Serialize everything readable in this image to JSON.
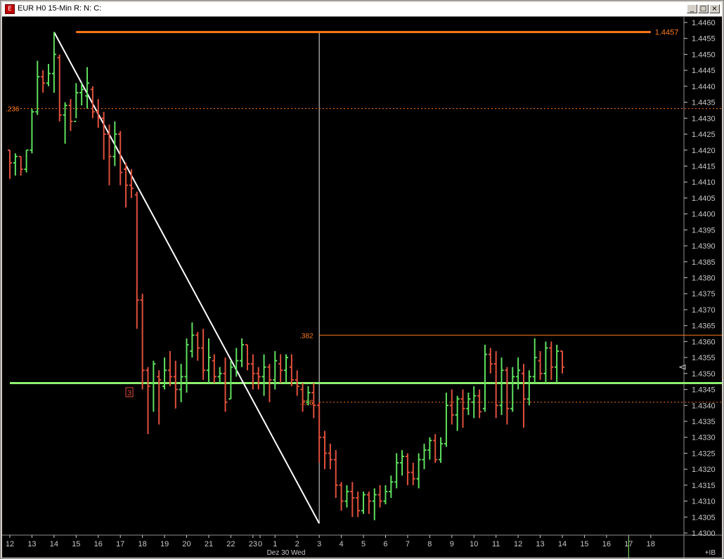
{
  "window": {
    "title": "EUR H0 15-Min R: N: C:",
    "icon": "chart-window-icon",
    "controls": {
      "minimize": "_",
      "maximize": "□",
      "close": "×"
    }
  },
  "colors": {
    "background": "#000000",
    "up_bar": "#5ee05e",
    "down_bar": "#e0503c",
    "neutral_bar": "#c8c8c8",
    "fib": "#ff7a1a",
    "support": "#90f070",
    "trendline": "#ffffff",
    "axis": "#c8c8c8"
  },
  "chart_data": {
    "type": "ohlc",
    "symbol": "EUR H0",
    "interval": "15-Min",
    "y_ticks": [
      "1.4460",
      "1.4455",
      "1.4450",
      "1.4445",
      "1.4440",
      "1.4435",
      "1.4430",
      "1.4425",
      "1.4420",
      "1.4415",
      "1.4410",
      "1.4405",
      "1.4400",
      "1.4395",
      "1.4390",
      "1.4385",
      "1.4380",
      "1.4375",
      "1.4370",
      "1.4365",
      "1.4360",
      "1.4355",
      "1.4350",
      "1.4345",
      "1.4340",
      "1.4335",
      "1.4330",
      "1.4325",
      "1.4320",
      "1.4315",
      "1.4310",
      "1.4305",
      "1.4300"
    ],
    "ylim": [
      1.43,
      1.446
    ],
    "x_ticks": [
      {
        "label": "12",
        "index": 0
      },
      {
        "label": "13",
        "index": 4
      },
      {
        "label": "14",
        "index": 8
      },
      {
        "label": "15",
        "index": 12
      },
      {
        "label": "16",
        "index": 16
      },
      {
        "label": "17",
        "index": 20
      },
      {
        "label": "18",
        "index": 24
      },
      {
        "label": "19",
        "index": 28
      },
      {
        "label": "20",
        "index": 32
      },
      {
        "label": "21",
        "index": 36
      },
      {
        "label": "22",
        "index": 40
      },
      {
        "label": "23",
        "index": 44
      },
      {
        "label": "0",
        "index": 45.3
      },
      {
        "label": "1",
        "index": 48
      },
      {
        "label": "2",
        "index": 52
      },
      {
        "label": "3",
        "index": 56
      },
      {
        "label": "4",
        "index": 60
      },
      {
        "label": "5",
        "index": 64
      },
      {
        "label": "6",
        "index": 68
      },
      {
        "label": "7",
        "index": 72
      },
      {
        "label": "8",
        "index": 76
      },
      {
        "label": "9",
        "index": 80
      },
      {
        "label": "10",
        "index": 84
      },
      {
        "label": "11",
        "index": 88
      },
      {
        "label": "12",
        "index": 92
      },
      {
        "label": "13",
        "index": 96
      },
      {
        "label": "14",
        "index": 100
      },
      {
        "label": "15",
        "index": 104
      },
      {
        "label": "16",
        "index": 108
      },
      {
        "label": "17",
        "index": 112
      },
      {
        "label": "18",
        "index": 116
      }
    ],
    "date_label": {
      "text": "Dez 30 Wed",
      "index": 50
    },
    "current_price_marker": 1.4352,
    "y_axis_extra": "+IB",
    "bars": [
      {
        "o": 1.442,
        "h": 1.442,
        "l": 1.4411,
        "c": 1.4416
      },
      {
        "o": 1.4416,
        "h": 1.4419,
        "l": 1.4412,
        "c": 1.4418
      },
      {
        "o": 1.4418,
        "h": 1.4418,
        "l": 1.4412,
        "c": 1.4414
      },
      {
        "o": 1.4414,
        "h": 1.442,
        "l": 1.4413,
        "c": 1.442
      },
      {
        "o": 1.442,
        "h": 1.4433,
        "l": 1.4419,
        "c": 1.4432
      },
      {
        "o": 1.4432,
        "h": 1.4448,
        "l": 1.4431,
        "c": 1.4443
      },
      {
        "o": 1.4443,
        "h": 1.4445,
        "l": 1.4438,
        "c": 1.4441
      },
      {
        "o": 1.4441,
        "h": 1.4447,
        "l": 1.444,
        "c": 1.4444
      },
      {
        "o": 1.4444,
        "h": 1.4457,
        "l": 1.4438,
        "c": 1.445
      },
      {
        "o": 1.4449,
        "h": 1.445,
        "l": 1.4429,
        "c": 1.4431
      },
      {
        "o": 1.4431,
        "h": 1.4435,
        "l": 1.4422,
        "c": 1.4434
      },
      {
        "o": 1.4434,
        "h": 1.4436,
        "l": 1.4426,
        "c": 1.4429
      },
      {
        "o": 1.4429,
        "h": 1.4441,
        "l": 1.443,
        "c": 1.4438
      },
      {
        "o": 1.4438,
        "h": 1.4441,
        "l": 1.4434,
        "c": 1.4439
      },
      {
        "o": 1.4437,
        "h": 1.4446,
        "l": 1.4433,
        "c": 1.4441
      },
      {
        "o": 1.4439,
        "h": 1.444,
        "l": 1.443,
        "c": 1.4432
      },
      {
        "o": 1.4432,
        "h": 1.4436,
        "l": 1.4427,
        "c": 1.443
      },
      {
        "o": 1.443,
        "h": 1.4432,
        "l": 1.4417,
        "c": 1.4425
      },
      {
        "o": 1.4425,
        "h": 1.4428,
        "l": 1.4409,
        "c": 1.4418
      },
      {
        "o": 1.4418,
        "h": 1.4429,
        "l": 1.4415,
        "c": 1.4425
      },
      {
        "o": 1.4425,
        "h": 1.4426,
        "l": 1.4409,
        "c": 1.4413
      },
      {
        "o": 1.4414,
        "h": 1.4416,
        "l": 1.4402,
        "c": 1.4409
      },
      {
        "o": 1.4409,
        "h": 1.4414,
        "l": 1.4405,
        "c": 1.4408
      },
      {
        "o": 1.4406,
        "h": 1.4407,
        "l": 1.4364,
        "c": 1.4373
      },
      {
        "o": 1.4373,
        "h": 1.4375,
        "l": 1.4345,
        "c": 1.4351
      },
      {
        "o": 1.4351,
        "h": 1.4352,
        "l": 1.4331,
        "c": 1.4346
      },
      {
        "o": 1.4347,
        "h": 1.4354,
        "l": 1.4338,
        "c": 1.4353
      },
      {
        "o": 1.4349,
        "h": 1.4351,
        "l": 1.4334,
        "c": 1.4348
      },
      {
        "o": 1.4346,
        "h": 1.4355,
        "l": 1.4345,
        "c": 1.4351
      },
      {
        "o": 1.4351,
        "h": 1.4357,
        "l": 1.4346,
        "c": 1.4349
      },
      {
        "o": 1.4349,
        "h": 1.4354,
        "l": 1.4339,
        "c": 1.4345
      },
      {
        "o": 1.4345,
        "h": 1.4353,
        "l": 1.4341,
        "c": 1.4349
      },
      {
        "o": 1.4349,
        "h": 1.4361,
        "l": 1.4344,
        "c": 1.4359
      },
      {
        "o": 1.4357,
        "h": 1.4366,
        "l": 1.4355,
        "c": 1.4362
      },
      {
        "o": 1.4362,
        "h": 1.4363,
        "l": 1.4354,
        "c": 1.4358
      },
      {
        "o": 1.4358,
        "h": 1.4364,
        "l": 1.4348,
        "c": 1.4351
      },
      {
        "o": 1.4351,
        "h": 1.4361,
        "l": 1.4347,
        "c": 1.4355
      },
      {
        "o": 1.4354,
        "h": 1.4356,
        "l": 1.4347,
        "c": 1.4349
      },
      {
        "o": 1.4349,
        "h": 1.4352,
        "l": 1.4347,
        "c": 1.435
      },
      {
        "o": 1.435,
        "h": 1.4355,
        "l": 1.4338,
        "c": 1.4341
      },
      {
        "o": 1.4342,
        "h": 1.4354,
        "l": 1.4342,
        "c": 1.4352
      },
      {
        "o": 1.4352,
        "h": 1.4358,
        "l": 1.4349,
        "c": 1.4354
      },
      {
        "o": 1.4354,
        "h": 1.4361,
        "l": 1.4352,
        "c": 1.4359
      },
      {
        "o": 1.4359,
        "h": 1.4359,
        "l": 1.4351,
        "c": 1.4353
      },
      {
        "o": 1.4353,
        "h": 1.4356,
        "l": 1.4345,
        "c": 1.435
      },
      {
        "o": 1.435,
        "h": 1.4352,
        "l": 1.4345,
        "c": 1.4349
      },
      {
        "o": 1.4349,
        "h": 1.4356,
        "l": 1.4343,
        "c": 1.4352
      },
      {
        "o": 1.4352,
        "h": 1.4353,
        "l": 1.4341,
        "c": 1.4348
      },
      {
        "o": 1.4348,
        "h": 1.4357,
        "l": 1.4345,
        "c": 1.4354
      },
      {
        "o": 1.4353,
        "h": 1.4356,
        "l": 1.4347,
        "c": 1.4351
      },
      {
        "o": 1.4351,
        "h": 1.4356,
        "l": 1.4347,
        "c": 1.4355
      },
      {
        "o": 1.4352,
        "h": 1.4356,
        "l": 1.4346,
        "c": 1.4348
      },
      {
        "o": 1.4348,
        "h": 1.4351,
        "l": 1.4343,
        "c": 1.4346
      },
      {
        "o": 1.4345,
        "h": 1.4347,
        "l": 1.4338,
        "c": 1.4341
      },
      {
        "o": 1.4341,
        "h": 1.4346,
        "l": 1.434,
        "c": 1.4344
      },
      {
        "o": 1.4344,
        "h": 1.4347,
        "l": 1.4336,
        "c": 1.434
      },
      {
        "o": 1.434,
        "h": 1.4341,
        "l": 1.4322,
        "c": 1.433
      },
      {
        "o": 1.433,
        "h": 1.4332,
        "l": 1.432,
        "c": 1.4325
      },
      {
        "o": 1.4325,
        "h": 1.4328,
        "l": 1.432,
        "c": 1.4323
      },
      {
        "o": 1.4323,
        "h": 1.4326,
        "l": 1.4311,
        "c": 1.4315
      },
      {
        "o": 1.4315,
        "h": 1.4316,
        "l": 1.4307,
        "c": 1.431
      },
      {
        "o": 1.431,
        "h": 1.4315,
        "l": 1.4308,
        "c": 1.4313
      },
      {
        "o": 1.4313,
        "h": 1.4316,
        "l": 1.4305,
        "c": 1.4311
      },
      {
        "o": 1.4311,
        "h": 1.4313,
        "l": 1.4305,
        "c": 1.4307
      },
      {
        "o": 1.4307,
        "h": 1.4313,
        "l": 1.4306,
        "c": 1.4312
      },
      {
        "o": 1.4312,
        "h": 1.4313,
        "l": 1.4306,
        "c": 1.431
      },
      {
        "o": 1.431,
        "h": 1.4314,
        "l": 1.4304,
        "c": 1.4312
      },
      {
        "o": 1.4312,
        "h": 1.4315,
        "l": 1.4308,
        "c": 1.431
      },
      {
        "o": 1.431,
        "h": 1.4315,
        "l": 1.4309,
        "c": 1.4313
      },
      {
        "o": 1.4313,
        "h": 1.4318,
        "l": 1.4311,
        "c": 1.4316
      },
      {
        "o": 1.4316,
        "h": 1.4325,
        "l": 1.4314,
        "c": 1.4322
      },
      {
        "o": 1.4322,
        "h": 1.4326,
        "l": 1.4318,
        "c": 1.4324
      },
      {
        "o": 1.4324,
        "h": 1.4325,
        "l": 1.4315,
        "c": 1.4319
      },
      {
        "o": 1.4319,
        "h": 1.4322,
        "l": 1.4315,
        "c": 1.4317
      },
      {
        "o": 1.4317,
        "h": 1.4325,
        "l": 1.4314,
        "c": 1.4323
      },
      {
        "o": 1.4323,
        "h": 1.4328,
        "l": 1.432,
        "c": 1.4326
      },
      {
        "o": 1.4326,
        "h": 1.433,
        "l": 1.4323,
        "c": 1.4329
      },
      {
        "o": 1.4329,
        "h": 1.4331,
        "l": 1.4322,
        "c": 1.4323
      },
      {
        "o": 1.4323,
        "h": 1.433,
        "l": 1.4322,
        "c": 1.4328
      },
      {
        "o": 1.4328,
        "h": 1.4344,
        "l": 1.4327,
        "c": 1.434
      },
      {
        "o": 1.434,
        "h": 1.4345,
        "l": 1.4334,
        "c": 1.4337
      },
      {
        "o": 1.4337,
        "h": 1.4343,
        "l": 1.4332,
        "c": 1.4342
      },
      {
        "o": 1.4342,
        "h": 1.4345,
        "l": 1.4333,
        "c": 1.4339
      },
      {
        "o": 1.4339,
        "h": 1.4344,
        "l": 1.4337,
        "c": 1.4342
      },
      {
        "o": 1.4341,
        "h": 1.4346,
        "l": 1.4336,
        "c": 1.4343
      },
      {
        "o": 1.4343,
        "h": 1.4345,
        "l": 1.4336,
        "c": 1.4338
      },
      {
        "o": 1.4339,
        "h": 1.4359,
        "l": 1.4338,
        "c": 1.4356
      },
      {
        "o": 1.4356,
        "h": 1.4358,
        "l": 1.435,
        "c": 1.4353
      },
      {
        "o": 1.4353,
        "h": 1.4357,
        "l": 1.4336,
        "c": 1.434
      },
      {
        "o": 1.434,
        "h": 1.4355,
        "l": 1.4337,
        "c": 1.4351
      },
      {
        "o": 1.4351,
        "h": 1.4352,
        "l": 1.4334,
        "c": 1.4339
      },
      {
        "o": 1.4339,
        "h": 1.4352,
        "l": 1.4338,
        "c": 1.4349
      },
      {
        "o": 1.4349,
        "h": 1.4355,
        "l": 1.4345,
        "c": 1.4351
      },
      {
        "o": 1.435,
        "h": 1.4353,
        "l": 1.4333,
        "c": 1.4342
      },
      {
        "o": 1.4342,
        "h": 1.4351,
        "l": 1.434,
        "c": 1.4349
      },
      {
        "o": 1.4349,
        "h": 1.4361,
        "l": 1.4347,
        "c": 1.4355
      },
      {
        "o": 1.4354,
        "h": 1.4357,
        "l": 1.4348,
        "c": 1.435
      },
      {
        "o": 1.435,
        "h": 1.436,
        "l": 1.4347,
        "c": 1.4358
      },
      {
        "o": 1.4358,
        "h": 1.436,
        "l": 1.4348,
        "c": 1.4352
      },
      {
        "o": 1.4352,
        "h": 1.4359,
        "l": 1.4347,
        "c": 1.4357
      },
      {
        "o": 1.4357,
        "h": 1.4357,
        "l": 1.435,
        "c": 1.4352
      }
    ],
    "levels": [
      {
        "price": 1.4457,
        "label": "1.4457",
        "style": "solid",
        "color": "#ff7a1a",
        "from": 12,
        "to": 116
      },
      {
        "price": 1.4347,
        "label": "1.4347",
        "style": "solid",
        "color": "#90f070",
        "from": 0,
        "to": 132
      },
      {
        "price": 1.4362,
        "label": "1.4362",
        "style": "solid-thin",
        "color": "#ff7a1a",
        "from": 56,
        "to": 141,
        "fib": ".382"
      },
      {
        "price": 1.4433,
        "label": "",
        "style": "dotted",
        "color": "#ff7a1a",
        "from": 0,
        "to": 148,
        "fib": ".236"
      },
      {
        "price": 1.4341,
        "label": "",
        "style": "dotted",
        "color": "#ff7a1a",
        "from": 56,
        "to": 148,
        "fib": ".236"
      }
    ],
    "trendline": {
      "from": {
        "index": 8,
        "price": 1.4457
      },
      "to": {
        "index": 56,
        "price": 1.4303
      }
    },
    "vline": {
      "index": 56
    },
    "wave_label": {
      "text": "3",
      "index": 21,
      "price": 1.4346
    }
  }
}
